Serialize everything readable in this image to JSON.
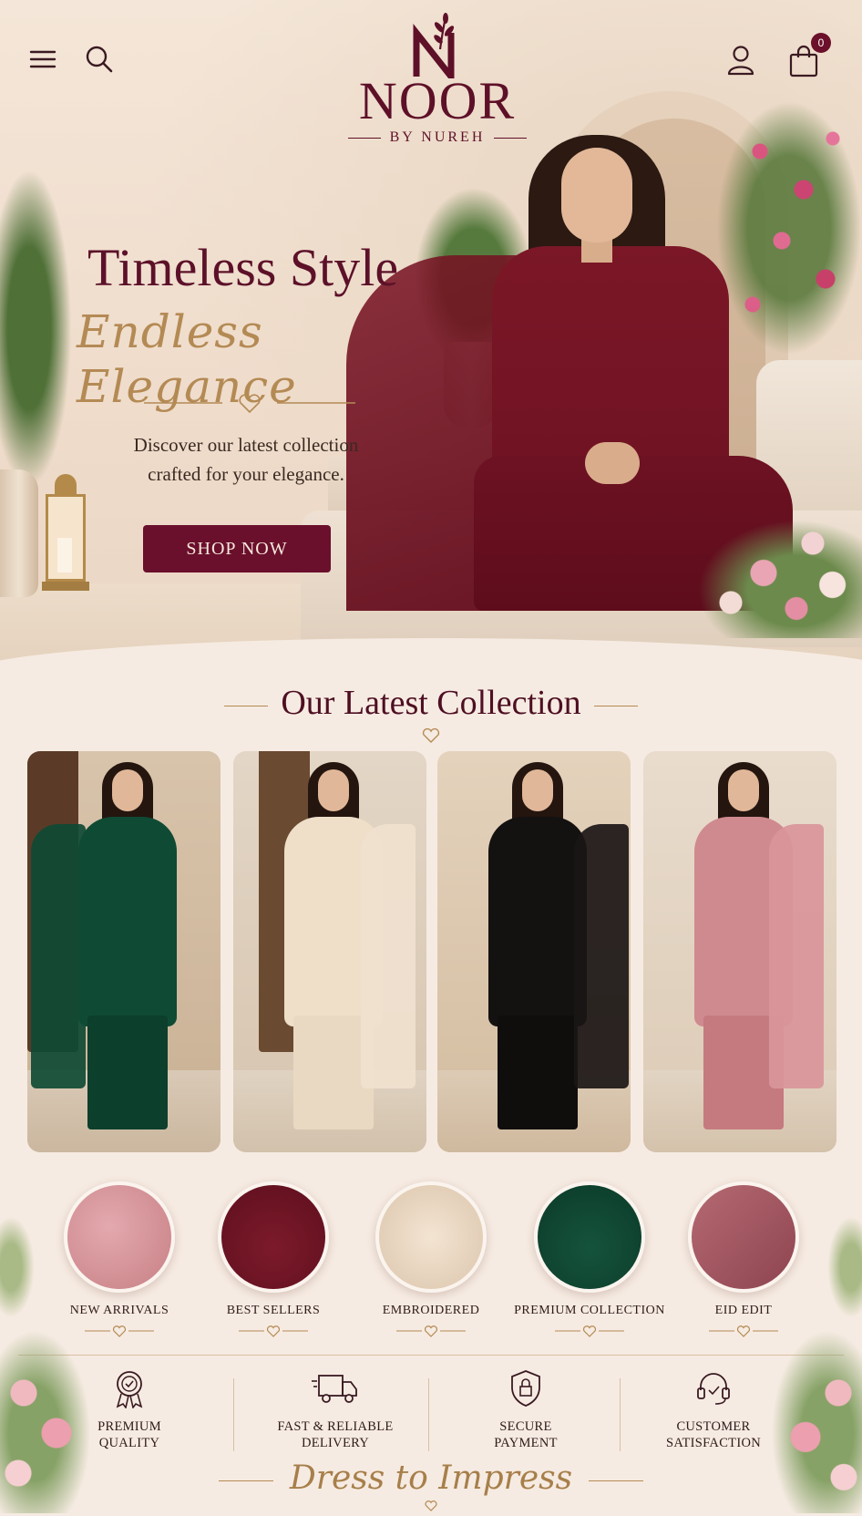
{
  "header": {
    "menu_icon": "hamburger-menu-icon",
    "search_icon": "search-icon",
    "user_icon": "user-icon",
    "cart_icon": "shopping-bag-icon",
    "cart_count": "0"
  },
  "brand": {
    "name": "NOOR",
    "subtitle": "BY NUREH"
  },
  "hero": {
    "title": "Timeless Style",
    "script": "Endless Elegance",
    "description_line1": "Discover our latest collection",
    "description_line2": "crafted for your elegance.",
    "cta_label": "SHOP NOW"
  },
  "collection": {
    "title": "Our Latest Collection",
    "products": [
      {
        "color": "#0f4a34"
      },
      {
        "color": "#efdfc9"
      },
      {
        "color": "#141111"
      },
      {
        "color": "#cf8a8f"
      }
    ]
  },
  "categories": [
    {
      "label": "NEW ARRIVALS"
    },
    {
      "label": "BEST SELLERS"
    },
    {
      "label": "EMBROIDERED"
    },
    {
      "label": "PREMIUM COLLECTION"
    },
    {
      "label": "EID EDIT"
    }
  ],
  "features": [
    {
      "icon": "award-badge-icon",
      "line1": "PREMIUM",
      "line2": "QUALITY"
    },
    {
      "icon": "delivery-truck-icon",
      "line1": "FAST & RELIABLE",
      "line2": "DELIVERY"
    },
    {
      "icon": "shield-lock-icon",
      "line1": "SECURE",
      "line2": "PAYMENT"
    },
    {
      "icon": "headset-icon",
      "line1": "CUSTOMER",
      "line2": "SATISFACTION"
    }
  ],
  "tagline": "Dress to Impress",
  "colors": {
    "brand": "#6a0f2c",
    "gold": "#b48a54",
    "background": "#f6ebe2"
  }
}
